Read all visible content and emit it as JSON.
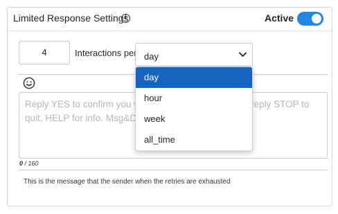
{
  "header": {
    "title": "Limited Response Settings",
    "info_icon": "info-icon",
    "active_label": "Active",
    "active_toggle_on": true,
    "toggle_color": "#1e88e5"
  },
  "limit": {
    "count_value": "4",
    "interactions_label": "Interactions per",
    "period_selected": "day",
    "chevron_icon": "chevron-down-icon"
  },
  "dropdown": {
    "options": [
      "day",
      "hour",
      "week",
      "all_time"
    ],
    "highlighted": "day",
    "highlight_color": "#1565c0"
  },
  "message": {
    "emoji_icon": "smiley-icon",
    "placeholder": "Reply YES to confirm you want to receive messages. Reply STOP to quit, HELP for info. Msg&DataRates may apply.",
    "char_count": "0",
    "char_limit": "/ 160"
  },
  "footer": {
    "help_text": "This is the message that the sender when the retries are exhausted"
  }
}
